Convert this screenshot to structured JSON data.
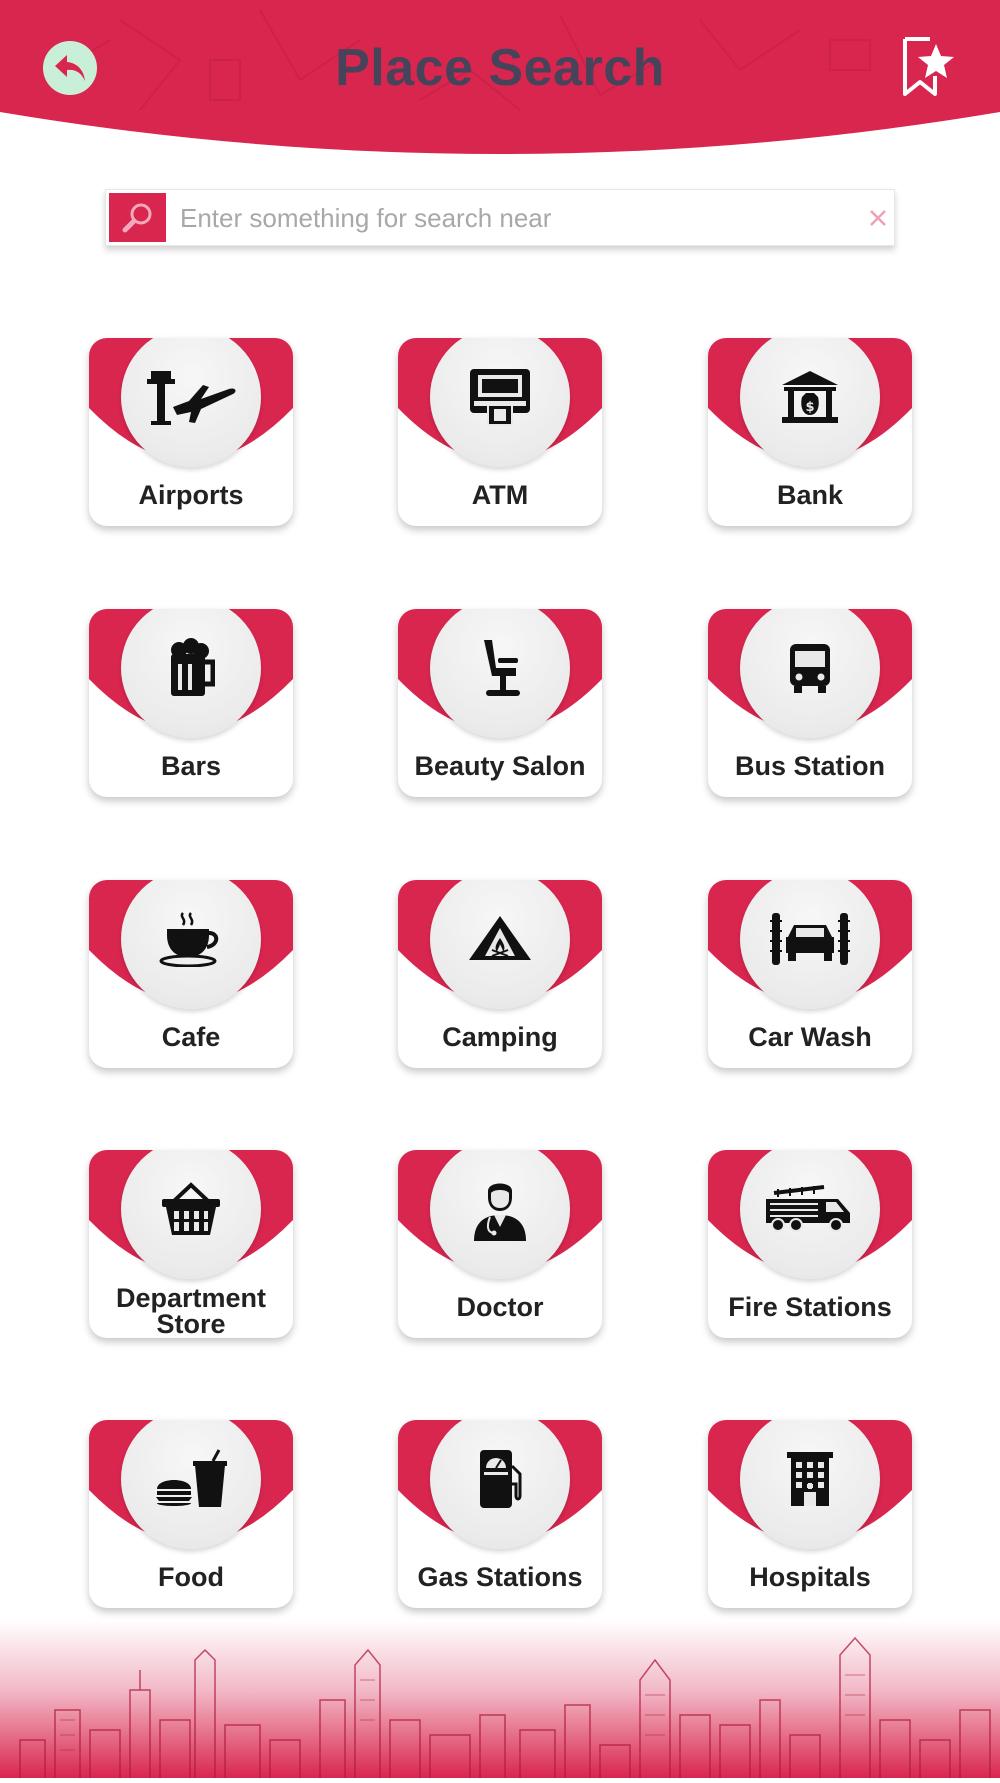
{
  "header": {
    "title": "Place Search",
    "back_icon": "back-arrow-icon",
    "bookmark_icon": "bookmark-star-icon"
  },
  "search": {
    "placeholder": "Enter something for search near",
    "value": "",
    "search_icon": "magnifier-icon",
    "clear_icon": "close-icon"
  },
  "colors": {
    "brand_red": "#d9264f",
    "title": "#47435a",
    "back_button_bg": "#c9efd9"
  },
  "categories": [
    {
      "label": "Airports",
      "icon": "airport-icon"
    },
    {
      "label": "ATM",
      "icon": "atm-icon"
    },
    {
      "label": "Bank",
      "icon": "bank-icon"
    },
    {
      "label": "Bars",
      "icon": "beer-mug-icon"
    },
    {
      "label": "Beauty Salon",
      "icon": "salon-chair-icon"
    },
    {
      "label": "Bus Station",
      "icon": "bus-icon"
    },
    {
      "label": "Cafe",
      "icon": "coffee-cup-icon"
    },
    {
      "label": "Camping",
      "icon": "tent-icon"
    },
    {
      "label": "Car Wash",
      "icon": "car-wash-icon"
    },
    {
      "label": "Department Store",
      "icon": "basket-icon"
    },
    {
      "label": "Doctor",
      "icon": "doctor-icon"
    },
    {
      "label": "Fire Stations",
      "icon": "fire-truck-icon"
    },
    {
      "label": "Food",
      "icon": "burger-drink-icon"
    },
    {
      "label": "Gas Stations",
      "icon": "fuel-pump-icon"
    },
    {
      "label": "Hospitals",
      "icon": "hospital-building-icon"
    }
  ]
}
